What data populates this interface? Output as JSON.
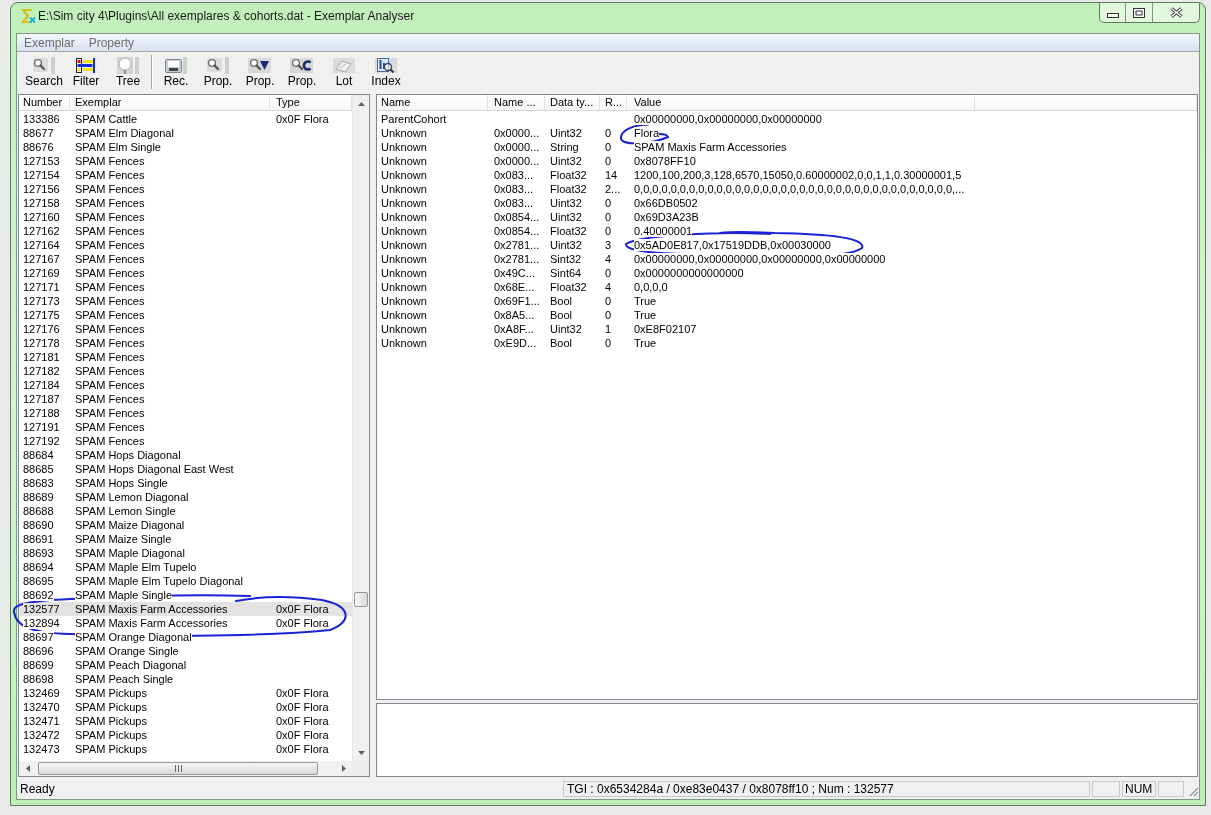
{
  "window": {
    "title": "E:\\Sim city 4\\Plugins\\All exemplares & cohorts.dat - Exemplar Analyser"
  },
  "menu": [
    {
      "label": "Exemplar"
    },
    {
      "label": "Property"
    }
  ],
  "toolbar": [
    [
      {
        "label": "Search",
        "kind": "search"
      },
      {
        "label": "Filter",
        "kind": "filter"
      },
      {
        "label": "Tree",
        "kind": "tree"
      }
    ],
    [
      {
        "label": "Rec.",
        "kind": "record"
      },
      {
        "label": "Prop.",
        "kind": "prop-search"
      },
      {
        "label": "Prop.",
        "kind": "prop-v"
      },
      {
        "label": "Prop.",
        "kind": "prop-c"
      },
      {
        "label": "Lot",
        "kind": "lot"
      },
      {
        "label": "Index",
        "kind": "index"
      }
    ]
  ],
  "exemplar_list": {
    "columns": [
      "Number",
      "Exemplar",
      "Type"
    ],
    "rows": [
      {
        "number": "133386",
        "exemplar": "SPAM Cattle",
        "type": "0x0F Flora",
        "selected": false
      },
      {
        "number": "88677",
        "exemplar": "SPAM Elm Diagonal",
        "selected": false
      },
      {
        "number": "88676",
        "exemplar": "SPAM Elm Single",
        "selected": false
      },
      {
        "number": "127153",
        "exemplar": "SPAM Fences",
        "selected": false
      },
      {
        "number": "127154",
        "exemplar": "SPAM Fences",
        "selected": false
      },
      {
        "number": "127156",
        "exemplar": "SPAM Fences",
        "selected": false
      },
      {
        "number": "127158",
        "exemplar": "SPAM Fences",
        "selected": false
      },
      {
        "number": "127160",
        "exemplar": "SPAM Fences",
        "selected": false
      },
      {
        "number": "127162",
        "exemplar": "SPAM Fences",
        "selected": false
      },
      {
        "number": "127164",
        "exemplar": "SPAM Fences",
        "selected": false
      },
      {
        "number": "127167",
        "exemplar": "SPAM Fences",
        "selected": false
      },
      {
        "number": "127169",
        "exemplar": "SPAM Fences",
        "selected": false
      },
      {
        "number": "127171",
        "exemplar": "SPAM Fences",
        "selected": false
      },
      {
        "number": "127173",
        "exemplar": "SPAM Fences",
        "selected": false
      },
      {
        "number": "127175",
        "exemplar": "SPAM Fences",
        "selected": false
      },
      {
        "number": "127176",
        "exemplar": "SPAM Fences",
        "selected": false
      },
      {
        "number": "127178",
        "exemplar": "SPAM Fences",
        "selected": false
      },
      {
        "number": "127181",
        "exemplar": "SPAM Fences",
        "selected": false
      },
      {
        "number": "127182",
        "exemplar": "SPAM Fences",
        "selected": false
      },
      {
        "number": "127184",
        "exemplar": "SPAM Fences",
        "selected": false
      },
      {
        "number": "127187",
        "exemplar": "SPAM Fences",
        "selected": false
      },
      {
        "number": "127188",
        "exemplar": "SPAM Fences",
        "selected": false
      },
      {
        "number": "127191",
        "exemplar": "SPAM Fences",
        "selected": false
      },
      {
        "number": "127192",
        "exemplar": "SPAM Fences",
        "selected": false
      },
      {
        "number": "88684",
        "exemplar": "SPAM Hops Diagonal",
        "selected": false
      },
      {
        "number": "88685",
        "exemplar": "SPAM Hops Diagonal East West",
        "selected": false
      },
      {
        "number": "88683",
        "exemplar": "SPAM Hops Single",
        "selected": false
      },
      {
        "number": "88689",
        "exemplar": "SPAM Lemon Diagonal",
        "selected": false
      },
      {
        "number": "88688",
        "exemplar": "SPAM Lemon Single",
        "selected": false
      },
      {
        "number": "88690",
        "exemplar": "SPAM Maize Diagonal",
        "selected": false
      },
      {
        "number": "88691",
        "exemplar": "SPAM Maize Single",
        "selected": false
      },
      {
        "number": "88693",
        "exemplar": "SPAM Maple Diagonal",
        "selected": false
      },
      {
        "number": "88694",
        "exemplar": "SPAM Maple Elm Tupelo",
        "selected": false
      },
      {
        "number": "88695",
        "exemplar": "SPAM Maple Elm Tupelo Diagonal",
        "selected": false
      },
      {
        "number": "88692",
        "exemplar": "SPAM Maple Single",
        "selected": false
      },
      {
        "number": "132577",
        "exemplar": "SPAM Maxis Farm Accessories",
        "type": "0x0F Flora",
        "selected": true
      },
      {
        "number": "132894",
        "exemplar": "SPAM Maxis Farm Accessories",
        "type": "0x0F Flora",
        "selected": false
      },
      {
        "number": "88697",
        "exemplar": "SPAM Orange Diagonal",
        "selected": false
      },
      {
        "number": "88696",
        "exemplar": "SPAM Orange Single",
        "selected": false
      },
      {
        "number": "88699",
        "exemplar": "SPAM Peach Diagonal",
        "selected": false
      },
      {
        "number": "88698",
        "exemplar": "SPAM Peach Single",
        "selected": false
      },
      {
        "number": "132469",
        "exemplar": "SPAM Pickups",
        "type": "0x0F Flora",
        "selected": false
      },
      {
        "number": "132470",
        "exemplar": "SPAM Pickups",
        "type": "0x0F Flora",
        "selected": false
      },
      {
        "number": "132471",
        "exemplar": "SPAM Pickups",
        "type": "0x0F Flora",
        "selected": false
      },
      {
        "number": "132472",
        "exemplar": "SPAM Pickups",
        "type": "0x0F Flora",
        "selected": false
      },
      {
        "number": "132473",
        "exemplar": "SPAM Pickups",
        "type": "0x0F Flora",
        "selected": false
      }
    ]
  },
  "properties": {
    "columns": [
      "Name",
      "Name ...",
      "Data ty...",
      "R...",
      "Value"
    ],
    "rows": [
      {
        "name": "ParentCohort",
        "value": "0x00000000,0x00000000,0x00000000"
      },
      {
        "name": "Unknown",
        "column_2": "0x0000...",
        "data_type": "Uint32",
        "column_4": "0",
        "value": "Flora"
      },
      {
        "name": "Unknown",
        "column_2": "0x0000...",
        "data_type": "String",
        "column_4": "0",
        "value": "SPAM Maxis Farm Accessories"
      },
      {
        "name": "Unknown",
        "column_2": "0x0000...",
        "data_type": "Uint32",
        "column_4": "0",
        "value": "0x8078FF10"
      },
      {
        "name": "Unknown",
        "column_2": "0x083...",
        "data_type": "Float32",
        "column_4": "14",
        "value": "1200,100,200,3,128,6570,15050,0.60000002,0,0,1,1,0.30000001,5"
      },
      {
        "name": "Unknown",
        "column_2": "0x083...",
        "data_type": "Float32",
        "column_4": "2...",
        "value": "0,0,0,0,0,0,0,0,0,0,0,0,0,0,0,0,0,0,0,0,0,0,0,0,0,0,0,0,0,0,0,0,0,0,0,..."
      },
      {
        "name": "Unknown",
        "column_2": "0x083...",
        "data_type": "Uint32",
        "column_4": "0",
        "value": "0x66DB0502"
      },
      {
        "name": "Unknown",
        "column_2": "0x0854...",
        "data_type": "Uint32",
        "column_4": "0",
        "value": "0x69D3A23B"
      },
      {
        "name": "Unknown",
        "column_2": "0x0854...",
        "data_type": "Float32",
        "column_4": "0",
        "value": "0.40000001"
      },
      {
        "name": "Unknown",
        "column_2": "0x2781...",
        "data_type": "Uint32",
        "column_4": "3",
        "value": "0x5AD0E817,0x17519DDB,0x00030000"
      },
      {
        "name": "Unknown",
        "column_2": "0x2781...",
        "data_type": "Sint32",
        "column_4": "4",
        "value": "0x00000000,0x00000000,0x00000000,0x00000000"
      },
      {
        "name": "Unknown",
        "column_2": "0x49C...",
        "data_type": "Sint64",
        "column_4": "0",
        "value": "0x0000000000000000"
      },
      {
        "name": "Unknown",
        "column_2": "0x68E...",
        "data_type": "Float32",
        "column_4": "4",
        "value": "0,0,0,0"
      },
      {
        "name": "Unknown",
        "column_2": "0x69F1...",
        "data_type": "Bool",
        "column_4": "0",
        "value": "True"
      },
      {
        "name": "Unknown",
        "column_2": "0x8A5...",
        "data_type": "Bool",
        "column_4": "0",
        "value": "True"
      },
      {
        "name": "Unknown",
        "column_2": "0xA8F...",
        "data_type": "Uint32",
        "column_4": "1",
        "value": "0xE8F02107"
      },
      {
        "name": "Unknown",
        "column_2": "0xE9D...",
        "data_type": "Bool",
        "column_4": "0",
        "value": "True"
      }
    ]
  },
  "status_bar": {
    "message": "Ready",
    "tgi": "TGI : 0x6534284a / 0xe83e0437 / 0x8078ff10 ; Num : 132577",
    "num_lock": "NUM"
  }
}
